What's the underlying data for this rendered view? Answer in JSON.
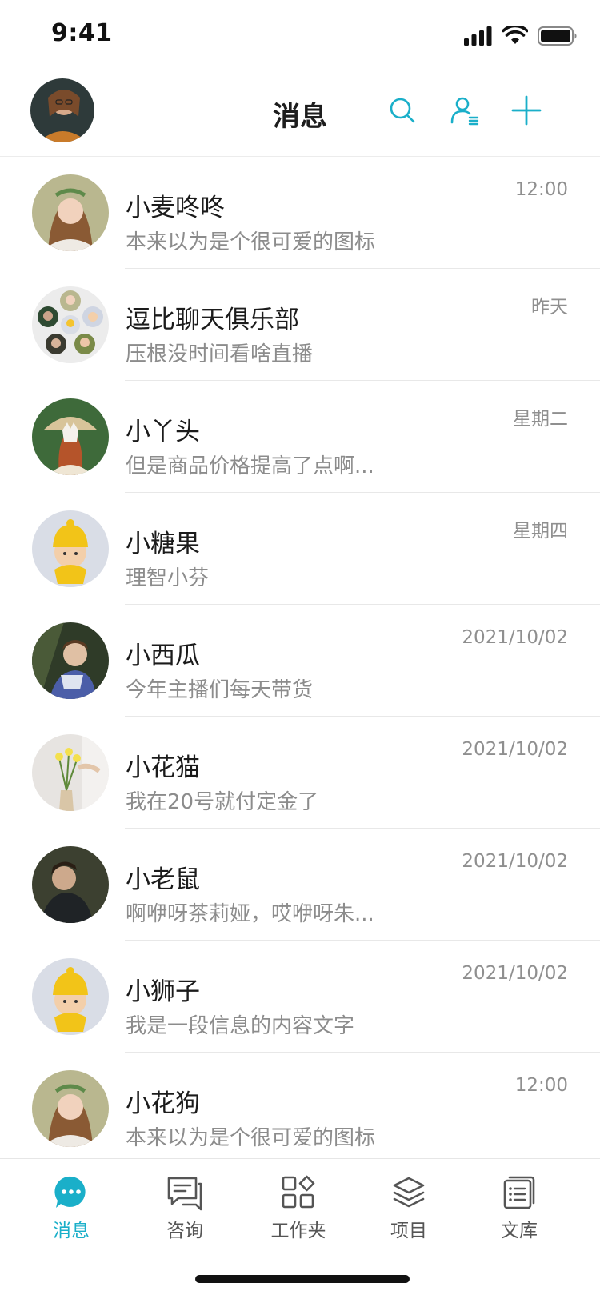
{
  "status_bar": {
    "time": "9:41"
  },
  "header": {
    "title": "消息"
  },
  "accent_color": "#1aafc9",
  "chats": [
    {
      "name": "小麦咚咚",
      "preview": "本来以为是个很可爱的图标",
      "time": "12:00"
    },
    {
      "name": "逗比聊天俱乐部",
      "preview": "压根没时间看啥直播",
      "time": "昨天"
    },
    {
      "name": "小丫头",
      "preview": "但是商品价格提高了点啊...",
      "time": "星期二"
    },
    {
      "name": "小糖果",
      "preview": "理智小芬",
      "time": "星期四"
    },
    {
      "name": "小西瓜",
      "preview": "今年主播们每天带货",
      "time": "2021/10/02"
    },
    {
      "name": "小花猫",
      "preview": "我在20号就付定金了",
      "time": "2021/10/02"
    },
    {
      "name": "小老鼠",
      "preview": "啊咿呀茶莉娅，哎咿呀朱...",
      "time": "2021/10/02"
    },
    {
      "name": "小狮子",
      "preview": "我是一段信息的内容文字",
      "time": "2021/10/02"
    },
    {
      "name": "小花狗",
      "preview": "本来以为是个很可爱的图标",
      "time": "12:00"
    }
  ],
  "tabs": [
    {
      "label": "消息",
      "icon": "chat-bubble-icon",
      "active": true
    },
    {
      "label": "咨询",
      "icon": "consult-icon",
      "active": false
    },
    {
      "label": "工作夹",
      "icon": "apps-icon",
      "active": false
    },
    {
      "label": "项目",
      "icon": "layers-icon",
      "active": false
    },
    {
      "label": "文库",
      "icon": "library-icon",
      "active": false
    }
  ]
}
